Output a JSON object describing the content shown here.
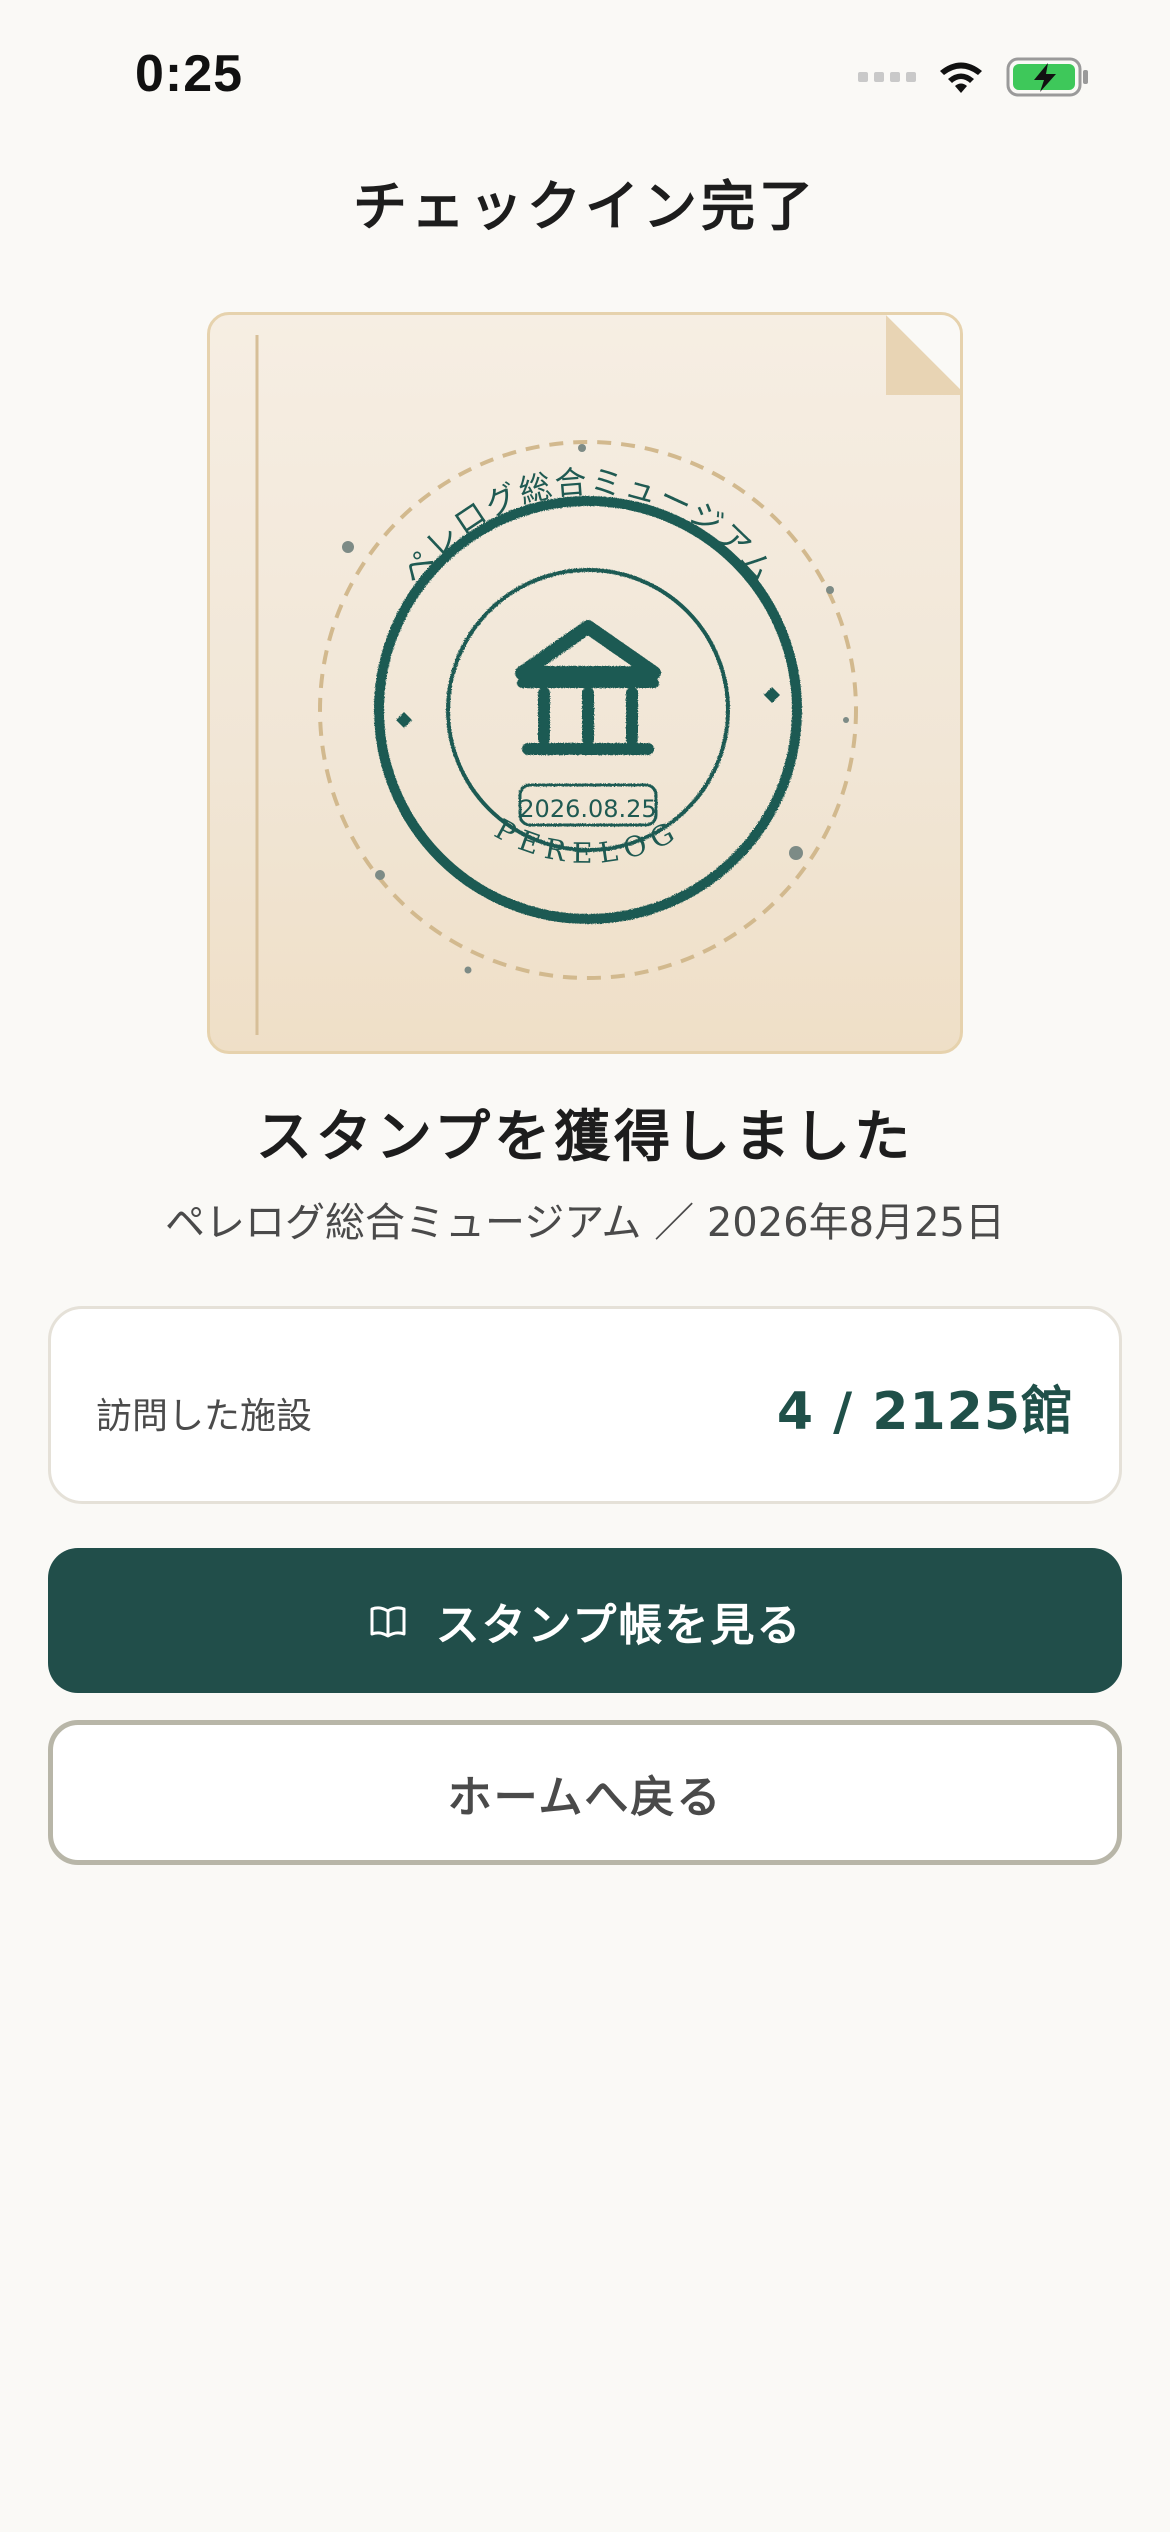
{
  "status_bar": {
    "time": "0:25"
  },
  "header": {
    "title": "チェックイン完了"
  },
  "stamp": {
    "museum_name": "ペレログ総合ミュージアム",
    "date": "2026.08.25",
    "brand": "PERELOG",
    "icon": "museum-icon"
  },
  "result": {
    "title": "スタンプを獲得しました",
    "subtitle": "ペレログ総合ミュージアム ／ 2026年8月25日"
  },
  "visited": {
    "label": "訪問した施設",
    "count": "4 / 2125館"
  },
  "actions": {
    "primary_label": "スタンプ帳を見る",
    "primary_icon": "book-icon",
    "secondary_label": "ホームへ戻る"
  },
  "colors": {
    "accent": "#214e4a",
    "stamp_ink": "#1f5a52",
    "background": "#faf9f6",
    "battery": "#3ec85a"
  }
}
